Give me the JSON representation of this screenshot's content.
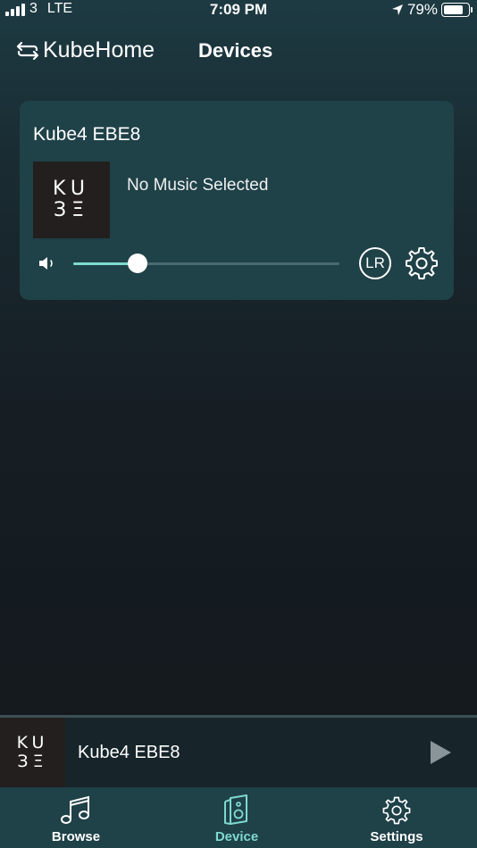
{
  "status_bar": {
    "carrier": "3",
    "network": "LTE",
    "time": "7:09 PM",
    "battery": "79%",
    "battery_level": 0.79
  },
  "header": {
    "app_title": "KubeHome",
    "page_title": "Devices",
    "switch_icon": "swap-arrows-icon"
  },
  "device_card": {
    "name": "Kube4 EBE8",
    "logo_line1": "KU",
    "logo_line2": "ЗΞ",
    "now_playing": "No Music Selected",
    "volume_level": 0.24,
    "lr_label": "LR",
    "settings_icon": "gear-icon"
  },
  "mini_player": {
    "logo_line1": "KU",
    "logo_line2": "ЗΞ",
    "device_name": "Kube4 EBE8",
    "play_icon": "play-icon"
  },
  "tabs": [
    {
      "label": "Browse",
      "icon": "music-note-icon",
      "active": false
    },
    {
      "label": "Device",
      "icon": "speaker-icon",
      "active": true
    },
    {
      "label": "Settings",
      "icon": "gear-icon",
      "active": false
    }
  ],
  "colors": {
    "accent": "#7ed9cf",
    "card": "#1f4148",
    "tab_bar": "#1f4148"
  }
}
